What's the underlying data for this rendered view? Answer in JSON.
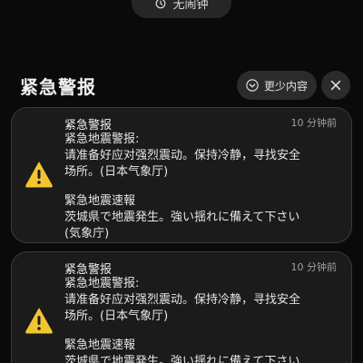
{
  "top_pill": {
    "label": "无闹钟",
    "icon": "alarm-clock-icon"
  },
  "header": {
    "title": "紧急警报",
    "collapse_label": "更少内容",
    "collapse_icon": "chevron-down-icon",
    "close_icon": "close-icon"
  },
  "notifications": [
    {
      "title": "紧急警报",
      "time": "10 分钟前",
      "icon": "warning-icon",
      "lines_cn": [
        "紧急地震警报:",
        "请准备好应对强烈震动。保持冷静，寻找安全",
        "场所。(日本气象厅)"
      ],
      "lines_jp": [
        "緊急地震速報",
        "茨城県で地震発生。強い揺れに備えて下さい",
        "(気象庁)"
      ]
    },
    {
      "title": "紧急警报",
      "time": "10 分钟前",
      "icon": "warning-icon",
      "lines_cn": [
        "紧急地震警报:",
        "请准备好应对强烈震动。保持冷静，寻找安全",
        "场所。(日本气象厅)"
      ],
      "lines_jp": [
        "緊急地震速報",
        "茨城県で地震発生。強い揺れに備えて下さい"
      ]
    }
  ],
  "colors": {
    "warning": "#f2c531",
    "background": "#0a0a0a",
    "card": "#1b1b1b"
  }
}
